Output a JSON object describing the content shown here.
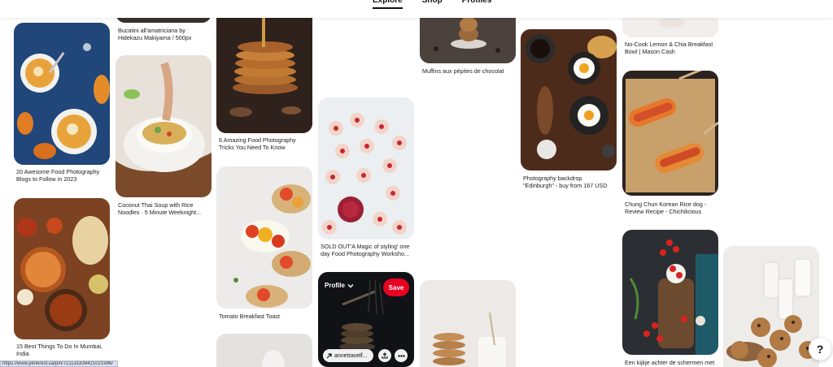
{
  "nav": {
    "tabs": [
      {
        "label": "Explore",
        "active": true
      },
      {
        "label": "Shop",
        "active": false
      },
      {
        "label": "Profiles",
        "active": false
      }
    ]
  },
  "pins": {
    "soup_bowls": {
      "title": "20 Awesome Food Photography Blogs to Follow in 2023"
    },
    "mumbai": {
      "title": "15 Best Things To Do In Mumbai, India"
    },
    "bucatini": {
      "title": "Bucatini all'amatriciana by Hidekazu Makiyama / 500px"
    },
    "thai_soup": {
      "title": "Coconut Thai Soup with Rice Noodles · 5 Minute Weeknight..."
    },
    "pancakes": {
      "title": "6 Amazing Food Photography Tricks You Need To Know"
    },
    "tomato_toast": {
      "title": "Tomato Breakfast Toast"
    },
    "cookies_hearts": {
      "title": "SOLD OUT'A Magic of styling' one day Food Photography Worksho..."
    },
    "pancake_stack_dark": {
      "profile_label": "Profile",
      "save_label": "Save",
      "link_label": "annetravelf...",
      "icons": [
        "chevron-down-icon",
        "arrow-up-right-icon",
        "upload-icon",
        "more-icon"
      ]
    },
    "muffins": {
      "title": "Muffins aux pépites de chocolat"
    },
    "breakfast_backdrop": {
      "title": "Photography backdrop \"Edinburgh\" - buy from 167 USD"
    },
    "no_cook": {
      "title": "No-Cook Lemon & Chia Breakfast Bowl | Mason Cash"
    },
    "rice_dog": {
      "title": "Chung Chun Korean Rice dog - Review Recipe - Chichilicious"
    },
    "tomatoes_board": {
      "title": "Een kijkje achter de schermen met"
    }
  },
  "help": {
    "label": "?"
  },
  "status_bar": {
    "url": "https://www.pinterest.ca/pin/721131839421021986/"
  }
}
